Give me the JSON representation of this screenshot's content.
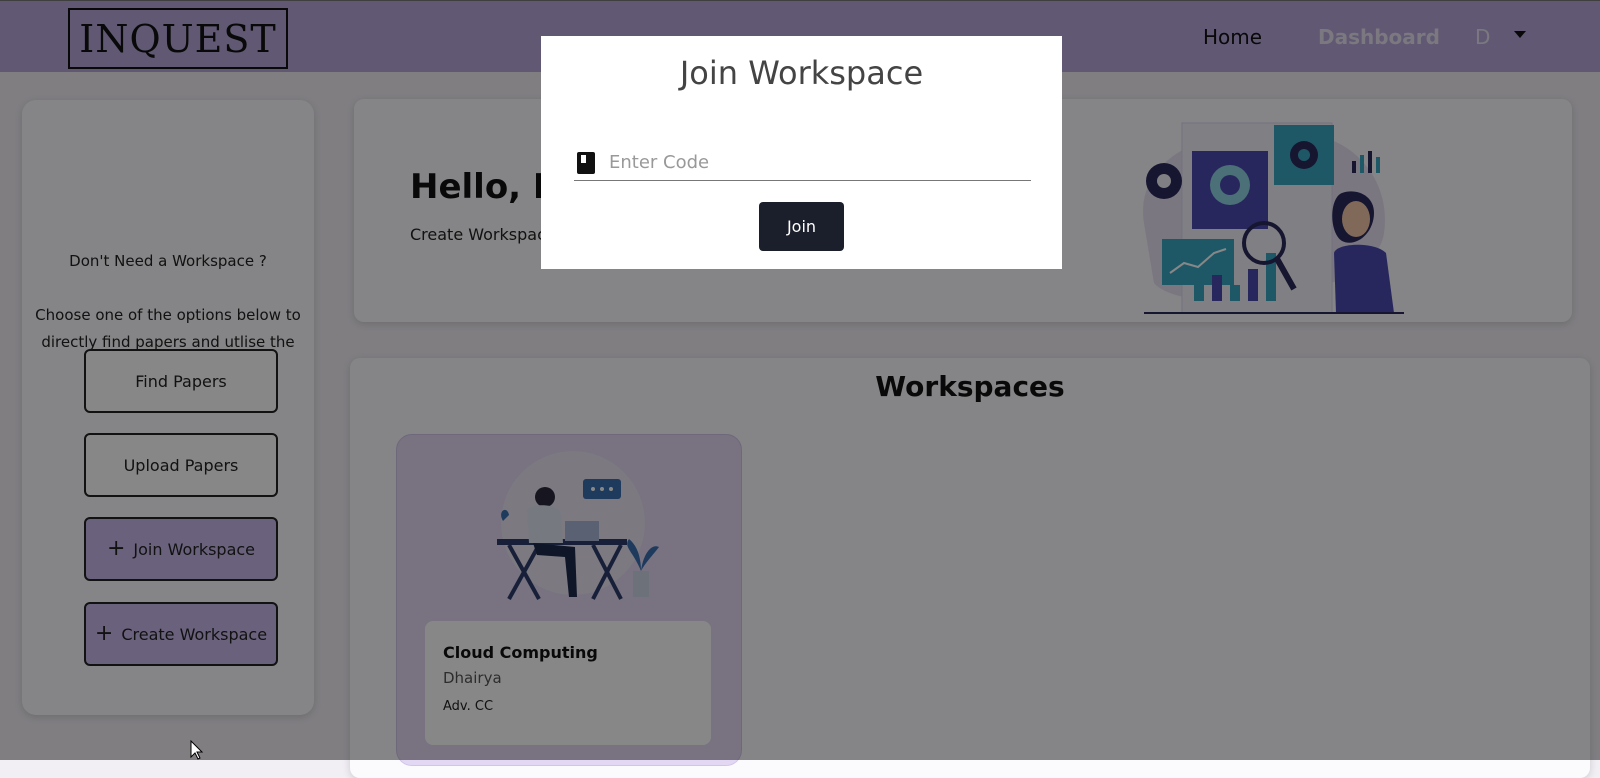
{
  "navbar": {
    "logo": "INQUEST",
    "home": "Home",
    "dashboard": "Dashboard",
    "user_initial": "D"
  },
  "sidebar": {
    "question": "Don't Need a Workspace ?",
    "description": "Choose one of the options below to directly find papers and utlise the features of Inquest",
    "buttons": {
      "find_papers": "Find Papers",
      "upload_papers": "Upload Papers",
      "join_workspace": "Join Workspace",
      "create_workspace": "Create Workspace"
    }
  },
  "hero": {
    "greeting": "Hello, D",
    "subtitle": "Create Workspac"
  },
  "workspaces": {
    "title": "Workspaces",
    "cards": [
      {
        "name": "Cloud Computing",
        "owner": "Dhairya",
        "tag": "Adv. CC"
      }
    ]
  },
  "modal": {
    "title": "Join Workspace",
    "code_placeholder": "Enter Code",
    "code_value": "",
    "join_label": "Join"
  },
  "colors": {
    "navbar": "#b7a6d9",
    "accent_button": "#c9b8ea",
    "card": "#e3d8f3",
    "join_button": "#1b1f2b"
  }
}
